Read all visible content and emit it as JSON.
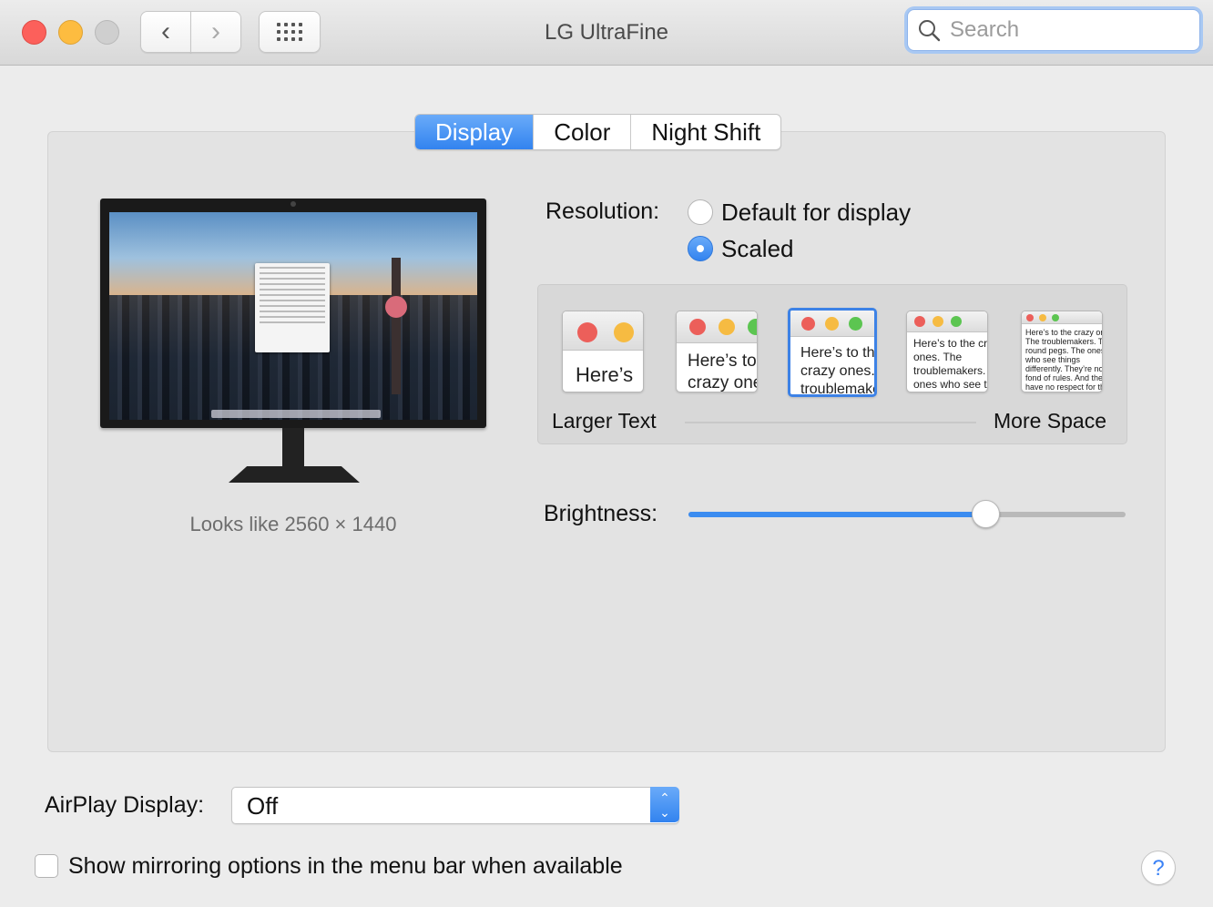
{
  "window": {
    "title": "LG UltraFine"
  },
  "toolbar": {
    "back_icon": "chevron-left-icon",
    "forward_icon": "chevron-right-icon",
    "grid_icon": "show-all-grid-icon",
    "search": {
      "placeholder": "Search",
      "value": "",
      "icon": "search-icon"
    }
  },
  "tabs": [
    {
      "label": "Display",
      "active": true
    },
    {
      "label": "Color",
      "active": false
    },
    {
      "label": "Night Shift",
      "active": false
    }
  ],
  "display": {
    "looks_like": "Looks like 2560 × 1440"
  },
  "resolution": {
    "label": "Resolution:",
    "options": [
      {
        "label": "Default for display",
        "selected": false
      },
      {
        "label": "Scaled",
        "selected": true
      }
    ]
  },
  "scaled": {
    "left_label": "Larger Text",
    "right_label": "More Space",
    "selected_index": 2,
    "thumbs": [
      {
        "text": "Here’s"
      },
      {
        "text": "Here’s to the crazy ones. The troublemakers."
      },
      {
        "text": "Here’s to the crazy ones. The troublemakers. The ones who see things"
      },
      {
        "text": "Here’s to the crazy ones. The troublemakers. The ones who see things differently. They’re not fond of rules. And they have no respect"
      },
      {
        "text": "Here’s to the crazy ones. The troublemakers. The round pegs. The ones who see things differently. They’re not fond of rules. And they have no respect for the status quo. You can quote them, disagree with them. About the only thing you can’t do is ignore them. Because they change things."
      }
    ]
  },
  "brightness": {
    "label": "Brightness:",
    "value": 0.68
  },
  "airplay": {
    "label": "AirPlay Display:",
    "value": "Off"
  },
  "mirroring": {
    "label": "Show mirroring options in the menu bar when available",
    "checked": false
  },
  "help": {
    "label": "?"
  },
  "colors": {
    "accent": "#3b8cf0",
    "close": "#fc605b",
    "minimize": "#fdbc40"
  }
}
